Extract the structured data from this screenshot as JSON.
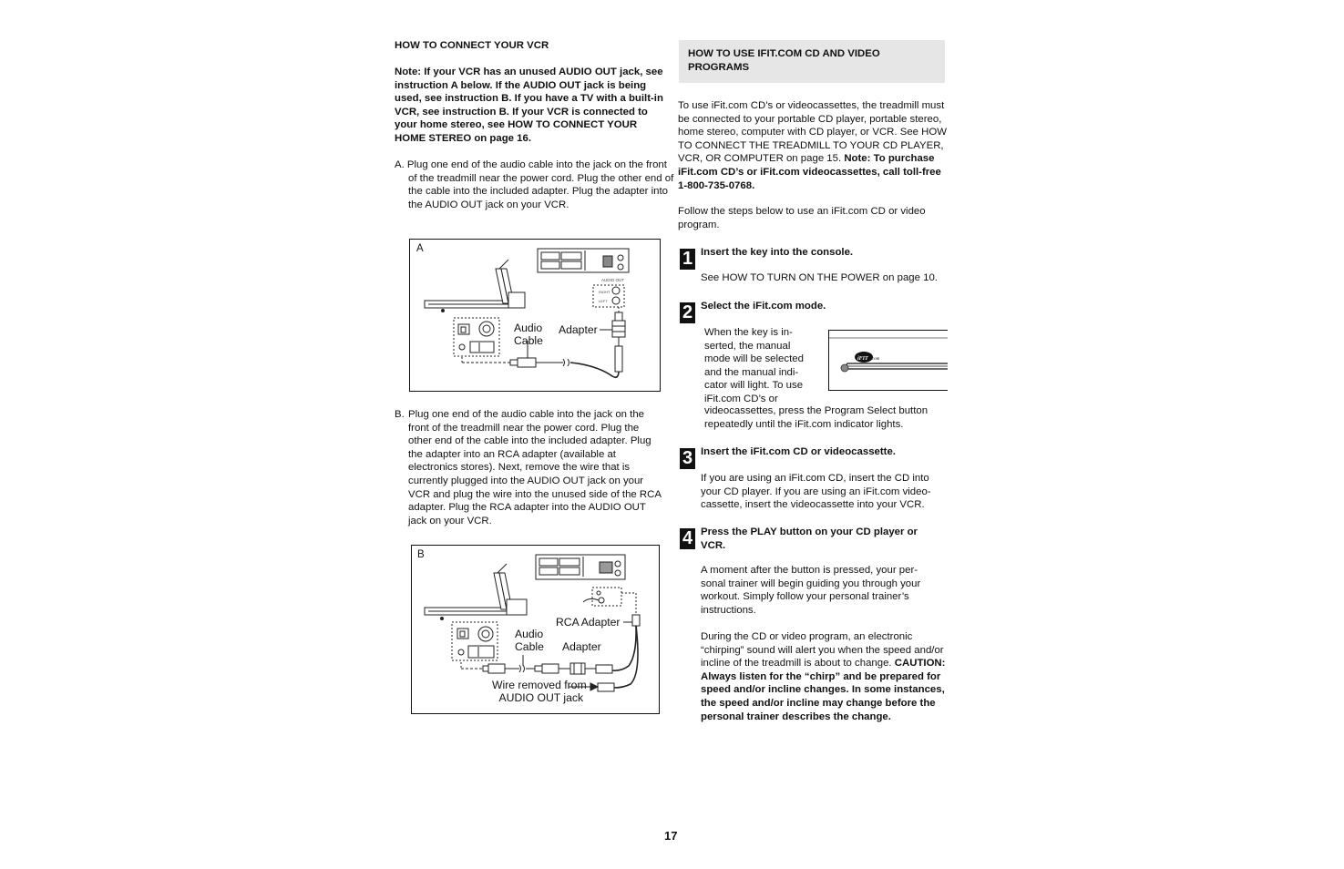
{
  "page_number": "17",
  "left_column": {
    "heading": "HOW TO CONNECT YOUR VCR",
    "note": "Note: If your VCR has an unused AUDIO OUT jack, see instruction A below. If the AUDIO OUT jack is being used, see instruction B. If you have a TV with a built-in VCR, see instruction B. If your VCR is connected to your home stereo, see HOW TO CONNECT YOUR HOME STEREO on page 16.",
    "instruction_a": "A. Plug one end of the audio cable into the jack on the front of the treadmill near the power cord. Plug the other end of the cable into the included adapter. Plug the adapter into the AUDIO OUT jack on your VCR.",
    "figure_a": {
      "letter": "A",
      "audio_cable_line1": "Audio",
      "audio_cable_line2": "Cable",
      "adapter": "Adapter",
      "audio_out_label": "AUDIO OUT",
      "right_label": "RIGHT",
      "left_label": "LEFT"
    },
    "instruction_b_marker": "B.",
    "instruction_b": "Plug one end of the audio cable into the jack on the front of the treadmill near the power cord. Plug the other end of the cable into the included adapter. Plug the adapter into an RCA adapter (available at electronics stores). Next, remove the wire that is currently plugged into the AUDIO OUT jack on your VCR and plug the wire into the unused side of the RCA adapter. Plug the RCA adapter into the AUDIO OUT jack on your VCR.",
    "figure_b": {
      "letter": "B",
      "rca_adapter": "RCA Adapter",
      "audio_cable_line1": "Audio",
      "audio_cable_line2": "Cable",
      "adapter": "Adapter",
      "wire_removed_line1": "Wire removed from",
      "wire_removed_line2": "AUDIO OUT jack"
    }
  },
  "right_column": {
    "heading_line1": "HOW TO USE IFIT.COM CD AND VIDEO",
    "heading_line2": "PROGRAMS",
    "intro": "To use iFit.com CD’s or videocassettes, the treadmill must be connected to your portable CD player, portable stereo, home stereo, computer with CD player, or VCR. See HOW TO CONNECT THE TREADMILL TO YOUR CD PLAYER, VCR, OR COMPUTER on page 15.",
    "intro_note": "Note: To purchase iFit.com CD’s or iFit.com videocassettes, call toll-free 1-800-735-0768.",
    "follow": "Follow the steps below to use an iFit.com CD or video program.",
    "steps": [
      {
        "number": "1",
        "title": "Insert the key into the console.",
        "body": "See HOW TO TURN ON THE POWER on page 10."
      },
      {
        "number": "2",
        "title": "Select the iFit.com mode.",
        "body_wrap": "When the key is in-serted, the manual mode will be selected and the manual indi-cator will light. To use iFit.com CD’s or",
        "body_rest": "videocassettes, press the Program Select button repeatedly until the iFit.com indicator lights.",
        "console_logo": "iFIT.com"
      },
      {
        "number": "3",
        "title": "Insert the iFit.com CD or videocassette.",
        "body": "If you are using an iFit.com CD, insert the CD into your CD player. If you are using an iFit.com video-cassette, insert the videocassette into your VCR."
      },
      {
        "number": "4",
        "title": "Press the PLAY button on your CD player or VCR.",
        "body": "A moment after the button is pressed, your per-sonal trainer will begin guiding you through your workout. Simply follow your personal trainer’s instructions.",
        "body2": "During the CD or video program, an electronic “chirping” sound will alert you when the speed and/or incline of the treadmill is about to change.",
        "caution": "CAUTION: Always listen for the “chirp” and be prepared for speed and/or incline changes. In some instances, the speed and/or incline may change before the personal trainer describes the change."
      }
    ]
  }
}
